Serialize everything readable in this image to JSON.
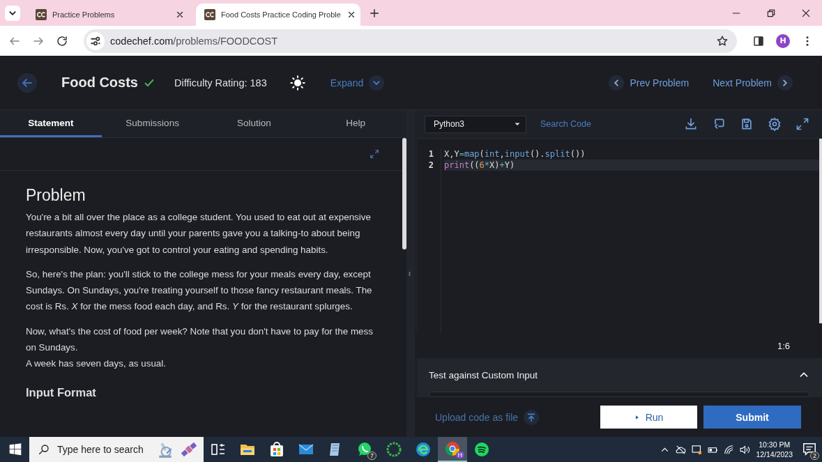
{
  "browser": {
    "tabs": [
      {
        "title": "Practice Problems",
        "selected": false
      },
      {
        "title": "Food Costs Practice Coding Proble",
        "selected": true
      }
    ],
    "url_host": "codechef.com",
    "url_path": "/problems/FOODCOST",
    "profile": "H"
  },
  "header": {
    "title": "Food Costs",
    "solved": true,
    "difficulty": "Difficulty Rating: 183",
    "expand": "Expand",
    "prev": "Prev Problem",
    "next": "Next Problem"
  },
  "tabs": [
    {
      "label": "Statement",
      "selected": true
    },
    {
      "label": "Submissions",
      "selected": false
    },
    {
      "label": "Solution",
      "selected": false
    },
    {
      "label": "Help",
      "selected": false
    }
  ],
  "statement": {
    "heading": "Problem",
    "paragraphs": [
      "You're a bit all over the place as a college student. You used to eat out at expensive restaurants almost every day until your parents gave you a talking-to about being irresponsible. Now, you've got to control your eating and spending habits.",
      "So, here's the plan: you'll stick to the college mess for your meals every day, except Sundays. On Sundays, you're treating yourself to those fancy restaurant meals. The cost is Rs. *X* for the mess food each day, and Rs. *Y* for the restaurant splurges.",
      "Now, what's the cost of food per week? Note that you don't have to pay for the mess on Sundays.\nA week has seven days, as usual."
    ],
    "subheading": "Input Format"
  },
  "editor": {
    "language": "Python3",
    "search": "Search Code",
    "lines": [
      {
        "number": "1",
        "tokens": [
          {
            "text": "X,Y",
            "kind": "plain"
          },
          {
            "text": "=",
            "kind": "op"
          },
          {
            "text": "map",
            "kind": "func"
          },
          {
            "text": "(",
            "kind": "plain"
          },
          {
            "text": "int",
            "kind": "func"
          },
          {
            "text": ",",
            "kind": "plain"
          },
          {
            "text": "input",
            "kind": "func"
          },
          {
            "text": "().",
            "kind": "plain"
          },
          {
            "text": "split",
            "kind": "func"
          },
          {
            "text": "())",
            "kind": "plain"
          }
        ]
      },
      {
        "number": "2",
        "tokens": [
          {
            "text": "print",
            "kind": "keyword"
          },
          {
            "text": "((",
            "kind": "plain"
          },
          {
            "text": "6",
            "kind": "number"
          },
          {
            "text": "*",
            "kind": "op"
          },
          {
            "text": "X)",
            "kind": "plain"
          },
          {
            "text": "+",
            "kind": "op"
          },
          {
            "text": "Y)",
            "kind": "plain"
          }
        ]
      }
    ],
    "cursor": "1:6"
  },
  "custom_input": {
    "title": "Test against Custom Input",
    "expanded": true
  },
  "actions": {
    "upload": "Upload code as file",
    "run": "Run",
    "submit": "Submit"
  },
  "taskbar": {
    "search_placeholder": "Type here to search",
    "whatsapp_badge": "7",
    "chrome_badge": "H",
    "time": "10:30 PM",
    "date": "12/14/2023",
    "notifications": "2"
  }
}
